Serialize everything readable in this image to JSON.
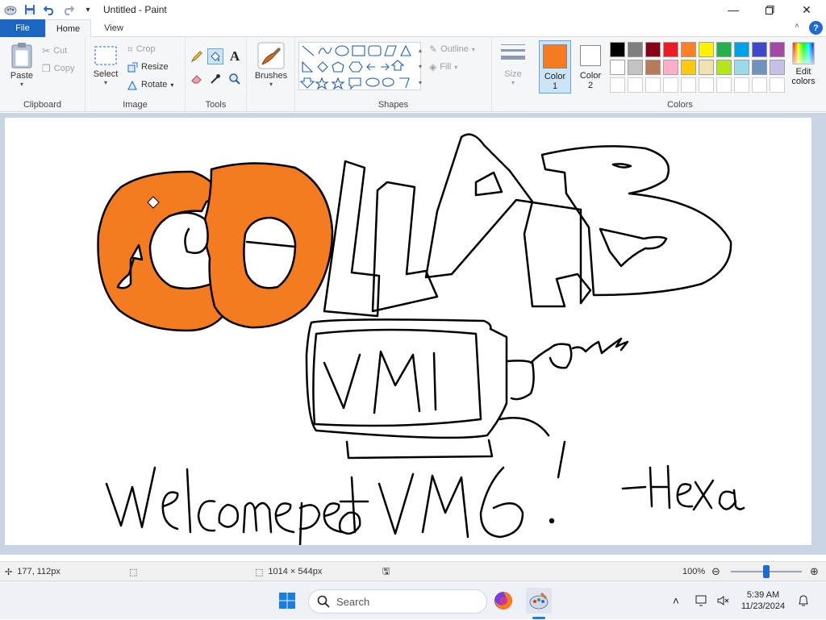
{
  "window": {
    "title": "Untitled - Paint"
  },
  "tabs": {
    "file": "File",
    "home": "Home",
    "view": "View"
  },
  "clipboard": {
    "paste": "Paste",
    "cut": "Cut",
    "copy": "Copy",
    "group": "Clipboard"
  },
  "image": {
    "select": "Select",
    "crop": "Crop",
    "resize": "Resize",
    "rotate": "Rotate",
    "group": "Image"
  },
  "tools": {
    "group": "Tools"
  },
  "brushes": {
    "label": "Brushes"
  },
  "shapes": {
    "outline": "Outline",
    "fill": "Fill",
    "group": "Shapes"
  },
  "size": {
    "label": "Size"
  },
  "colors": {
    "color1_label": "Color",
    "color1_num": "1",
    "color2_label": "Color",
    "color2_num": "2",
    "edit_label1": "Edit",
    "edit_label2": "colors",
    "group": "Colors",
    "color1_value": "#f47b20",
    "color2_value": "#ffffff",
    "row1": [
      "#000000",
      "#7f7f7f",
      "#880015",
      "#ed1c24",
      "#ff7f27",
      "#fff200",
      "#22b14c",
      "#00a2e8",
      "#3f48cc",
      "#a349a4"
    ],
    "row2": [
      "#ffffff",
      "#c3c3c3",
      "#b97a57",
      "#ffaec9",
      "#ffc90e",
      "#efe4b0",
      "#b5e61d",
      "#99d9ea",
      "#7092be",
      "#c8bfe7"
    ]
  },
  "status": {
    "cursor": "177, 112px",
    "canvas_size": "1014 × 544px",
    "zoom": "100%",
    "zoom_level": 0.5
  },
  "taskbar": {
    "search_placeholder": "Search",
    "time": "5:39 AM",
    "date": "11/23/2024"
  }
}
